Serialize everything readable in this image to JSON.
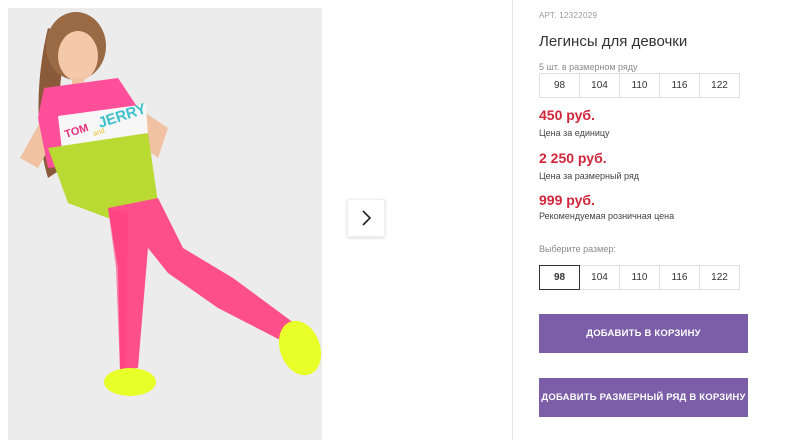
{
  "product": {
    "article": "АРТ. 12322029",
    "title": "Легинсы для девочки"
  },
  "size_set": {
    "label": "5 шт. в размерном ряду",
    "sizes": [
      "98",
      "104",
      "110",
      "116",
      "122"
    ]
  },
  "prices": [
    {
      "amount": "450 руб.",
      "note": "Цена за единицу"
    },
    {
      "amount": "2 250 руб.",
      "note": "Цена за размерный ряд"
    },
    {
      "amount": "999 руб.",
      "note": "Рекомендуемая розничная цена"
    }
  ],
  "size_select": {
    "label": "Выберите размер:",
    "sizes": [
      "98",
      "104",
      "110",
      "116",
      "122"
    ],
    "selected": "98"
  },
  "buttons": {
    "add_to_cart": "ДОБАВИТЬ В КОРЗИНУ",
    "add_set_to_cart": "ДОБАВИТЬ РАЗМЕРНЫЙ РЯД В КОРЗИНУ"
  },
  "photo_print": {
    "line1": "TOM",
    "line2": "and",
    "line3": "JERRY"
  },
  "colors": {
    "price": "#d0263b",
    "button": "#7b5ea7",
    "leggings": "#ff4f8a",
    "shirt_pink": "#ff4f9a",
    "shirt_lime": "#b9d933",
    "shoes": "#e8ff2a"
  },
  "icons": {
    "next": "chevron-right-icon"
  }
}
